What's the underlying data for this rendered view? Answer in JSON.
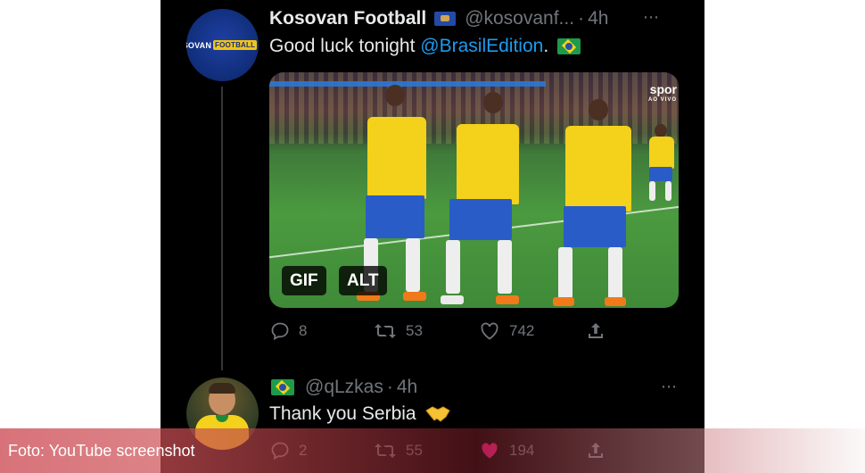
{
  "tweet": {
    "author_name": "Kosovan Football",
    "author_handle": "@kosovanf...",
    "separator": "·",
    "time": "4h",
    "text_before": "Good luck tonight ",
    "mention": "@BrasilEdition",
    "text_after": ".",
    "avatar_text": "KOSOVAN",
    "avatar_badge": "FOOTBALL",
    "media": {
      "overlay_brand": "spor",
      "overlay_sub": "AO VIVO",
      "gif_label": "GIF",
      "alt_label": "ALT"
    },
    "stats": {
      "replies": "8",
      "retweets": "53",
      "likes": "742"
    }
  },
  "reply": {
    "author_handle": "@qLzkas",
    "separator": "·",
    "time": "4h",
    "text": "Thank you Serbia",
    "stats": {
      "replies": "2",
      "retweets": "55",
      "likes": "194"
    }
  },
  "caption": "Foto: YouTube screenshot",
  "icons": {
    "more": "⋯"
  },
  "colors": {
    "background": "#000000",
    "text": "#e7e9ea",
    "muted": "#71767b",
    "link": "#1d9bf0",
    "like_active": "#f91880"
  }
}
